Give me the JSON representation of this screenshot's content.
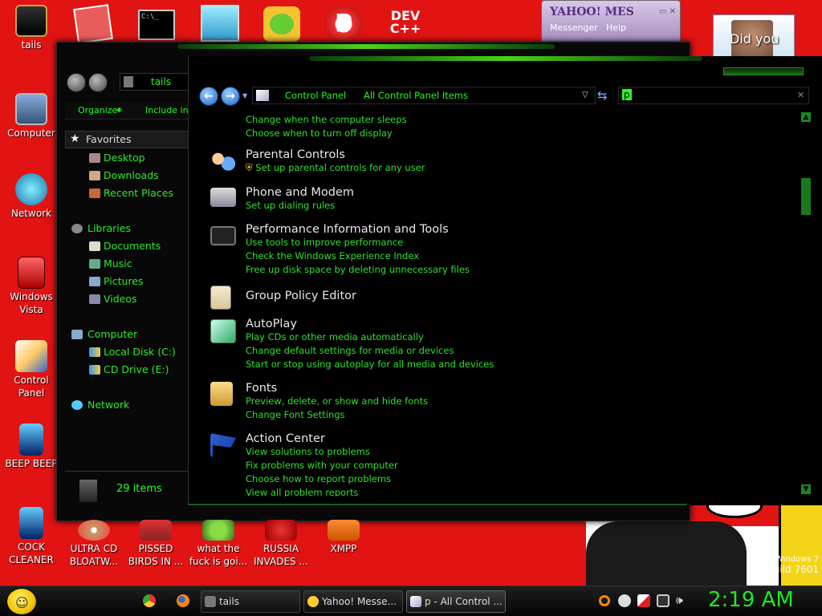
{
  "desktop": {
    "left_icons": [
      {
        "label": "tails",
        "icon": "user-folder-icon"
      },
      {
        "label": "Computer",
        "icon": "computer-icon"
      },
      {
        "label": "Network",
        "icon": "network-globe-icon"
      },
      {
        "label": "Windows Vista",
        "icon": "recycle-bin-icon"
      },
      {
        "label": "Control Panel",
        "icon": "control-panel-icon"
      },
      {
        "label": "BEEP BEEP",
        "icon": "app-shortcut-icon"
      },
      {
        "label": "COCK CLEANER",
        "icon": "app-shortcut-icon"
      }
    ],
    "bottom_icons": [
      {
        "label": "ULTRA CD BLOATW...",
        "icon": "cd-icon"
      },
      {
        "label": "PISSED BIRDS IN ...",
        "icon": "angry-birds-icon"
      },
      {
        "label": "what the fuck is goi...",
        "icon": "pig-icon"
      },
      {
        "label": "RUSSIA INVADES ...",
        "icon": "game-icon"
      },
      {
        "label": "XMPP",
        "icon": "xampp-icon"
      }
    ],
    "top_row_text": {
      "dev": "DEV",
      "cpp": "C++"
    },
    "watermark": {
      "line1": "Windows 7",
      "line2": "Build 7601"
    }
  },
  "yahoo": {
    "logo": "YAHOO! MES",
    "menu_messenger": "Messenger",
    "menu_help": "Help",
    "did_you": "Did you"
  },
  "explorer": {
    "path": "tails",
    "organize": "Organize",
    "include": "Include in li",
    "favorites": "Favorites",
    "fav_items": [
      "Desktop",
      "Downloads",
      "Recent Places"
    ],
    "libraries": "Libraries",
    "lib_items": [
      "Documents",
      "Music",
      "Pictures",
      "Videos"
    ],
    "computer": "Computer",
    "drives": [
      "Local Disk (C:)",
      "CD Drive (E:)"
    ],
    "network": "Network",
    "status": "29 items"
  },
  "control_panel": {
    "breadcrumb": [
      "Control Panel",
      "All Control Panel Items"
    ],
    "search_value": "p",
    "top_links": [
      "Change when the computer sleeps",
      "Choose when to turn off display"
    ],
    "categories": [
      {
        "title": "Parental Controls",
        "links": [
          "Set up parental controls for any user"
        ]
      },
      {
        "title": "Phone and Modem",
        "links": [
          "Set up dialing rules"
        ]
      },
      {
        "title": "Performance Information and Tools",
        "links": [
          "Use tools to improve performance",
          "Check the Windows Experience Index",
          "Free up disk space by deleting unnecessary files"
        ]
      },
      {
        "title": "Group Policy Editor",
        "links": []
      },
      {
        "title": "AutoPlay",
        "links": [
          "Play CDs or other media automatically",
          "Change default settings for media or devices",
          "Start or stop using autoplay for all media and devices"
        ]
      },
      {
        "title": "Fonts",
        "links": [
          "Preview, delete, or show and hide fonts",
          "Change Font Settings"
        ]
      },
      {
        "title": "Action Center",
        "links": [
          "View solutions to problems",
          "Fix problems with your computer",
          "Choose how to report problems",
          "View all problem reports"
        ]
      }
    ]
  },
  "taskbar": {
    "buttons": [
      "tails",
      "Yahoo! Messe...",
      "p - All Control ..."
    ],
    "clock": "2:19 AM"
  },
  "colors": {
    "accent": "#29f729",
    "desktop_bg": "#e21313"
  }
}
